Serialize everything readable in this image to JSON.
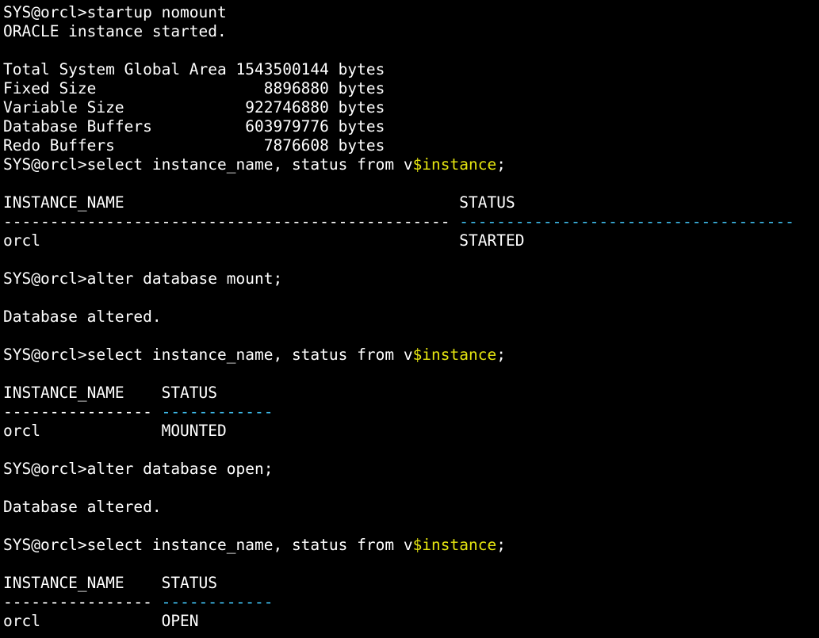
{
  "window": {
    "background": "#000000",
    "foreground": "#ffffff",
    "accent_yellow": "#e5e510",
    "accent_cyan": "#3db9e8"
  },
  "terminal": {
    "lines": [
      {
        "segments": [
          {
            "text": "SYS@orcl>startup nomount"
          }
        ]
      },
      {
        "segments": [
          {
            "text": "ORACLE instance started."
          }
        ]
      },
      {
        "segments": [
          {
            "text": ""
          }
        ]
      },
      {
        "segments": [
          {
            "text": "Total System Global Area 1543500144 bytes"
          }
        ]
      },
      {
        "segments": [
          {
            "text": "Fixed Size                  8896880 bytes"
          }
        ]
      },
      {
        "segments": [
          {
            "text": "Variable Size             922746880 bytes"
          }
        ]
      },
      {
        "segments": [
          {
            "text": "Database Buffers          603979776 bytes"
          }
        ]
      },
      {
        "segments": [
          {
            "text": "Redo Buffers                7876608 bytes"
          }
        ]
      },
      {
        "segments": [
          {
            "text": "SYS@orcl>select instance_name, status from v"
          },
          {
            "text": "$instance",
            "style": "accent"
          },
          {
            "text": ";"
          }
        ]
      },
      {
        "segments": [
          {
            "text": ""
          }
        ]
      },
      {
        "segments": [
          {
            "text": "INSTANCE_NAME                                    STATUS"
          }
        ]
      },
      {
        "segments": [
          {
            "text": "------------------------------------------------ "
          },
          {
            "text": "------------------------------------",
            "style": "dash-cyan"
          }
        ]
      },
      {
        "segments": [
          {
            "text": "orcl                                             STARTED"
          }
        ]
      },
      {
        "segments": [
          {
            "text": ""
          }
        ]
      },
      {
        "segments": [
          {
            "text": "SYS@orcl>alter database mount;"
          }
        ]
      },
      {
        "segments": [
          {
            "text": ""
          }
        ]
      },
      {
        "segments": [
          {
            "text": "Database altered."
          }
        ]
      },
      {
        "segments": [
          {
            "text": ""
          }
        ]
      },
      {
        "segments": [
          {
            "text": "SYS@orcl>select instance_name, status from v"
          },
          {
            "text": "$instance",
            "style": "accent"
          },
          {
            "text": ";"
          }
        ]
      },
      {
        "segments": [
          {
            "text": ""
          }
        ]
      },
      {
        "segments": [
          {
            "text": "INSTANCE_NAME    STATUS"
          }
        ]
      },
      {
        "segments": [
          {
            "text": "---------------- "
          },
          {
            "text": "------------",
            "style": "dash-cyan"
          }
        ]
      },
      {
        "segments": [
          {
            "text": "orcl             MOUNTED"
          }
        ]
      },
      {
        "segments": [
          {
            "text": ""
          }
        ]
      },
      {
        "segments": [
          {
            "text": "SYS@orcl>alter database open;"
          }
        ]
      },
      {
        "segments": [
          {
            "text": ""
          }
        ]
      },
      {
        "segments": [
          {
            "text": "Database altered."
          }
        ]
      },
      {
        "segments": [
          {
            "text": ""
          }
        ]
      },
      {
        "segments": [
          {
            "text": "SYS@orcl>select instance_name, status from v"
          },
          {
            "text": "$instance",
            "style": "accent"
          },
          {
            "text": ";"
          }
        ]
      },
      {
        "segments": [
          {
            "text": ""
          }
        ]
      },
      {
        "segments": [
          {
            "text": "INSTANCE_NAME    STATUS"
          }
        ]
      },
      {
        "segments": [
          {
            "text": "---------------- "
          },
          {
            "text": "------------",
            "style": "dash-cyan"
          }
        ]
      },
      {
        "segments": [
          {
            "text": "orcl             OPEN"
          }
        ]
      }
    ]
  }
}
